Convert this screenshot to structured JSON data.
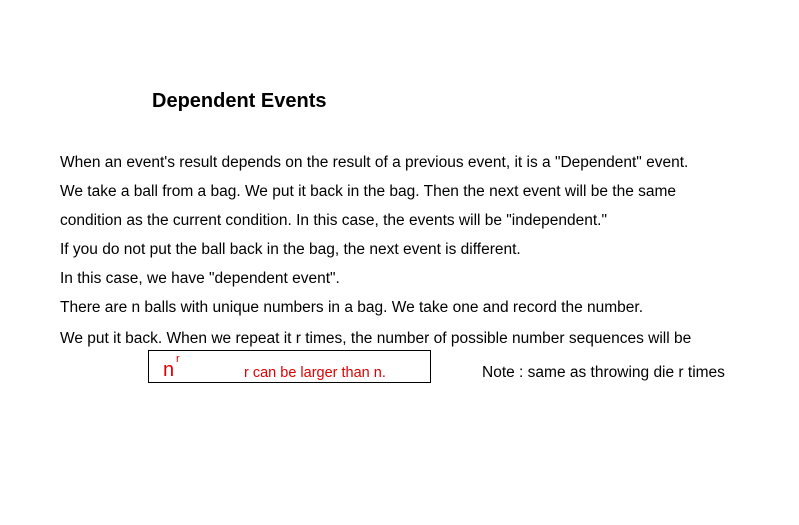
{
  "title": "Dependent Events",
  "lines": [
    "When an event's result depends on the result of a previous event, it is a \"Dependent\" event.",
    "We take a ball from a bag. We put it back in the bag. Then the next event will be the same",
    "condition as the current condition. In this case, the events will be \"independent.\"",
    "If you do not put the ball back in the bag, the next event is different.",
    "In this case, we have \"dependent event\".",
    "There are n balls with unique numbers in a bag. We take one and record the number.",
    "We put it back. When we repeat it r times, the number of possible number sequences will be"
  ],
  "formula": {
    "base": "n",
    "exponent": "r",
    "note": "r can be larger than n."
  },
  "side_note": "Note : same as throwing die r times",
  "colors": {
    "formula_text": "#e00000",
    "body_text": "#000000"
  }
}
